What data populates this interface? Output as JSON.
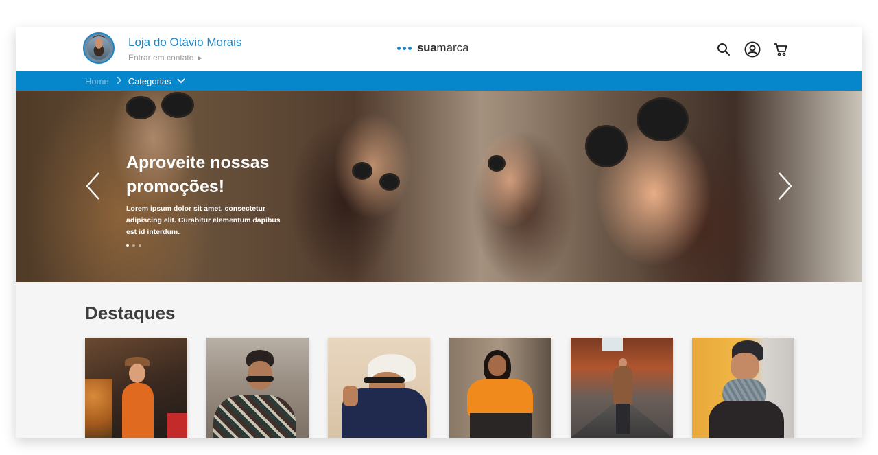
{
  "header": {
    "store_name": "Loja do Otávio Morais",
    "contact_label": "Entrar em contato",
    "contact_arrow": "▶",
    "brand_bold": "sua",
    "brand_regular": "marca",
    "icons": [
      "search-icon",
      "user-icon",
      "cart-icon"
    ]
  },
  "breadcrumb": {
    "home": "Home",
    "separator": ">",
    "categories": "Categorias"
  },
  "hero": {
    "title": "Aproveite nossas promoções!",
    "text": "Lorem ipsum dolor sit amet, consectetur adipiscing elit. Curabitur elementum dapibus est id interdum.",
    "slides": 3,
    "active_slide": 1
  },
  "section": {
    "title": "Destaques"
  },
  "colors": {
    "accent": "#0787cb",
    "store_name": "#1a86c8",
    "background": "#f5f5f5"
  }
}
